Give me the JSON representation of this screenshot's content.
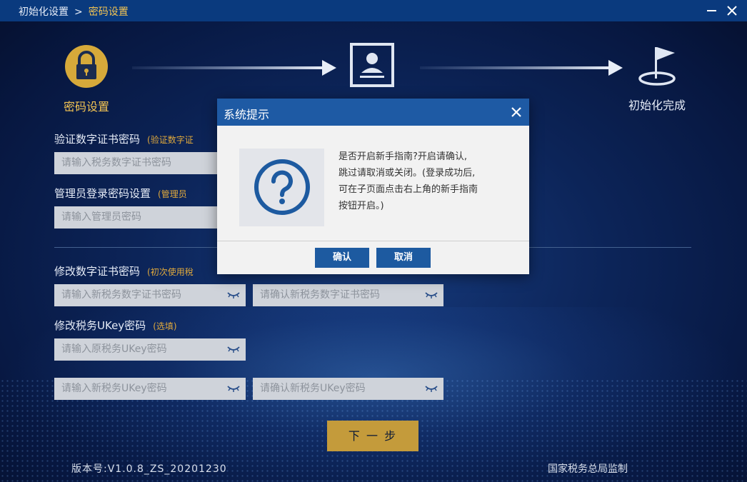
{
  "titlebar": {
    "crumb_root": "初始化设置",
    "crumb_sep": ">",
    "crumb_current": "密码设置"
  },
  "steps": [
    {
      "label": "密码设置",
      "icon": "lock-icon"
    },
    {
      "label": "",
      "icon": "id-card-icon"
    },
    {
      "label": "初始化完成",
      "icon": "flag-icon"
    }
  ],
  "form": {
    "verify_cert_label": "验证数字证书密码",
    "verify_cert_hint": "(验证数字证",
    "verify_cert_placeholder": "请输入税务数字证书密码",
    "admin_label": "管理员登录密码设置",
    "admin_hint": "(管理员",
    "admin_placeholder": "请输入管理员密码",
    "change_cert_label": "修改数字证书密码",
    "change_cert_hint": "(初次使用稅",
    "new_cert_placeholder": "请输入新税务数字证书密码",
    "confirm_cert_placeholder": "请确认新税务数字证书密码",
    "ukey_label": "修改税务UKey密码",
    "ukey_hint": "(选填)",
    "old_ukey_placeholder": "请输入原税务UKey密码",
    "new_ukey_placeholder": "请输入新税务UKey密码",
    "confirm_ukey_placeholder": "请确认新税务UKey密码"
  },
  "next_button": "下 一 步",
  "footer": {
    "version": "版本号:V1.0.8_ZS_20201230",
    "authority": "国家税务总局监制"
  },
  "dialog": {
    "title": "系统提示",
    "message_lines": [
      "是否开启新手指南?开启请确认,",
      "跳过请取消或关闭。(登录成功后,",
      "可在子页面点击右上角的新手指南",
      "按钮开启。)"
    ],
    "confirm_label": "确认",
    "cancel_label": "取消"
  },
  "colors": {
    "accent_gold": "#c49b3b",
    "dialog_header": "#1e5aa4",
    "button_blue": "#1d5aa0"
  }
}
